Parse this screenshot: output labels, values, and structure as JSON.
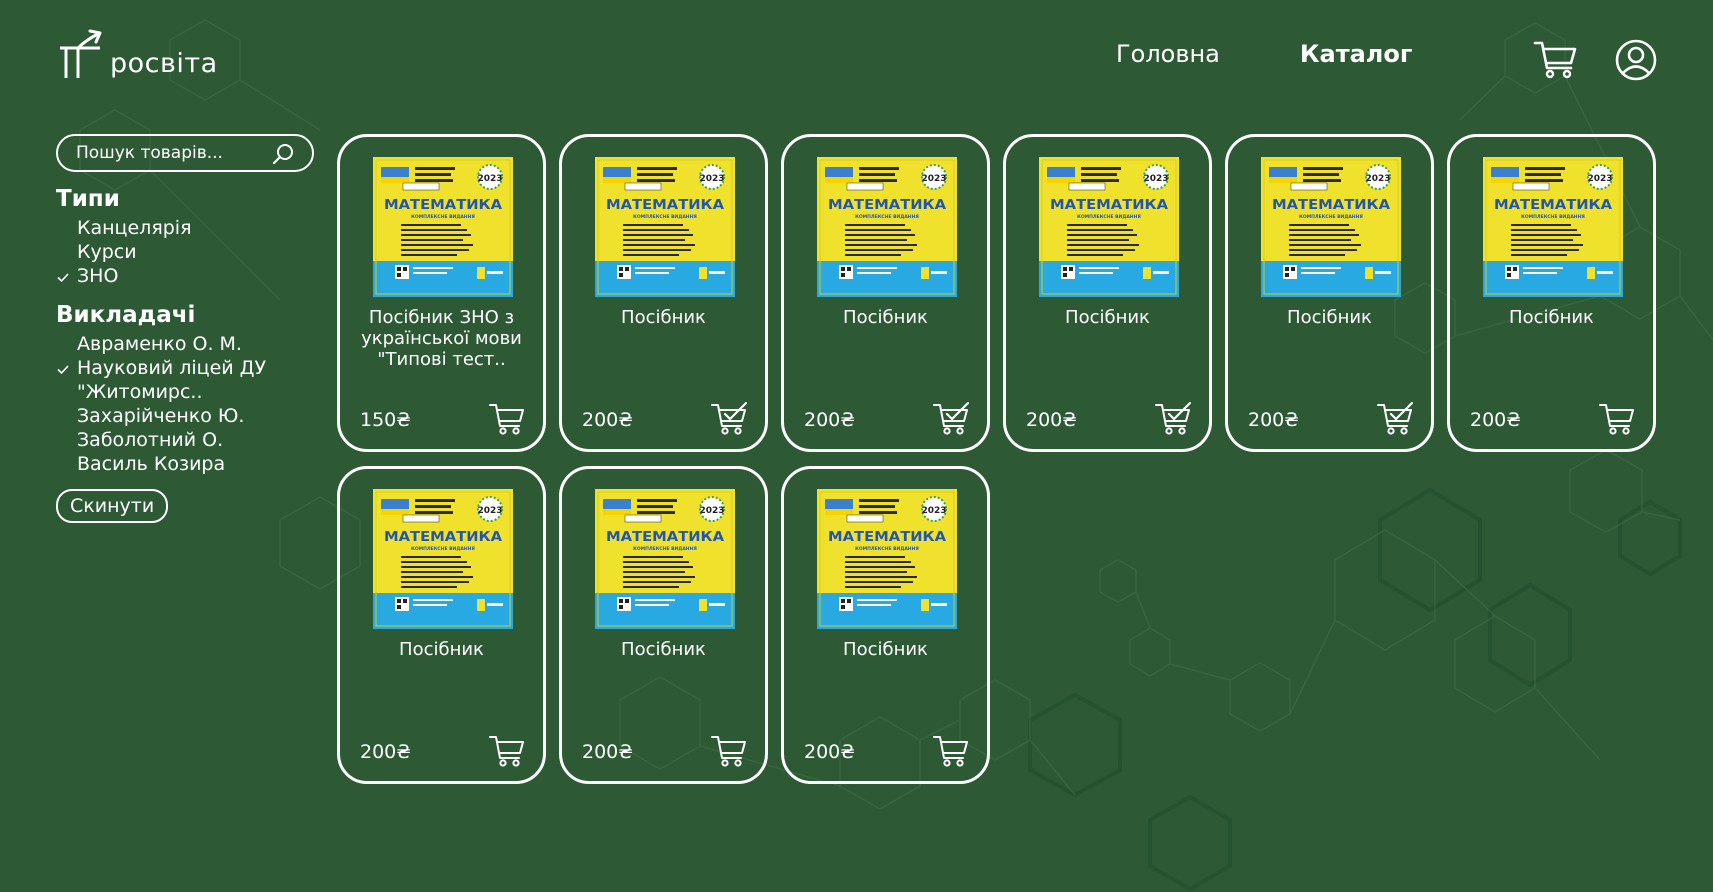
{
  "header": {
    "logo_text": "росвіта",
    "nav": [
      {
        "label": "Головна",
        "active": false
      },
      {
        "label": "Каталог",
        "active": true
      }
    ],
    "icons": [
      "cart-icon",
      "user-icon"
    ]
  },
  "sidebar": {
    "search": {
      "placeholder": "Пошук товарів..."
    },
    "groups": [
      {
        "title": "Типи",
        "items": [
          {
            "label": "Канцелярія",
            "checked": false
          },
          {
            "label": "Курси",
            "checked": false
          },
          {
            "label": "ЗНО",
            "checked": true
          }
        ]
      },
      {
        "title": "Викладачі",
        "items": [
          {
            "label": "Авраменко О. М.",
            "checked": false
          },
          {
            "label": "Науковий ліцей ДУ",
            "checked": true
          },
          {
            "label": "\"Житомирс..",
            "checked": false
          },
          {
            "label": "Захарійченко Ю.",
            "checked": false
          },
          {
            "label": "Заболотний О.",
            "checked": false
          },
          {
            "label": "Василь Козира",
            "checked": false
          }
        ]
      }
    ],
    "reset_label": "Скинути"
  },
  "products": [
    {
      "title": "Посібник ЗНО з української мови \"Типові тест..",
      "price": "150₴",
      "in_cart": false
    },
    {
      "title": "Посібник",
      "price": "200₴",
      "in_cart": true
    },
    {
      "title": "Посібник",
      "price": "200₴",
      "in_cart": true
    },
    {
      "title": "Посібник",
      "price": "200₴",
      "in_cart": true
    },
    {
      "title": "Посібник",
      "price": "200₴",
      "in_cart": true
    },
    {
      "title": "Посібник",
      "price": "200₴",
      "in_cart": false
    },
    {
      "title": "Посібник",
      "price": "200₴",
      "in_cart": false
    },
    {
      "title": "Посібник",
      "price": "200₴",
      "in_cart": false
    },
    {
      "title": "Посібник",
      "price": "200₴",
      "in_cart": false
    }
  ],
  "book_cover": {
    "title": "МАТЕМАТИКА",
    "subtitle": "КОМПЛЕКСНЕ ВИДАННЯ",
    "year": "2023",
    "colors": {
      "yellow": "#f0e22c",
      "blue": "#29a9e1",
      "title_blue": "#1f56b3"
    }
  },
  "colors": {
    "background": "#2d5a35",
    "foreground": "#ffffff"
  }
}
